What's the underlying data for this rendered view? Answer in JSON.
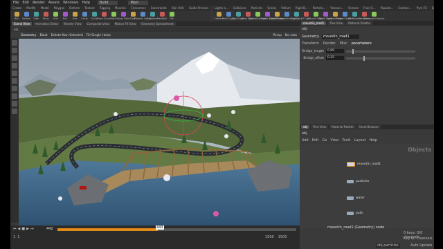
{
  "app": {
    "menu": [
      "File",
      "Edit",
      "Render",
      "Assets",
      "Windows",
      "Help"
    ],
    "build": "Build",
    "desktop": "Main"
  },
  "shelf_left": {
    "tabs": [
      "Create",
      "Modify",
      "Model",
      "Polygon",
      "Deform",
      "Texture",
      "Rigging",
      "Muscles",
      "Characters",
      "Constraints",
      "Hair Utils",
      "Guide Process",
      "Terrain FX",
      "Simple FX",
      "Cloud FX",
      "Volume"
    ],
    "tools": [
      "Box",
      "Sphere",
      "Tube",
      "Torus",
      "Grid",
      "Null",
      "Line",
      "Circle",
      "Curve",
      "Draw Curve",
      "Path",
      "Spray Paint",
      "Font",
      "Platonic Solids",
      "L-System",
      "Metaball",
      "File"
    ]
  },
  "shelf_right": {
    "tabs": [
      "Lights a...",
      "Collisions",
      "Particles",
      "Grains",
      "Vellum",
      "Rigid B...",
      "Particle...",
      "Viscous...",
      "Oceans",
      "Fluid C...",
      "Populat...",
      "Contain...",
      "Pyro FX",
      "Sparse...",
      "FEM",
      "Wires",
      "Crowds",
      "Drive Si..."
    ],
    "tools": [
      "Camera",
      "Point Light",
      "Spot Light",
      "Area Light",
      "Geometry Light",
      "Volume Light",
      "Distant Light",
      "Environment Light",
      "Sky Light",
      "GI Light",
      "Caustic Light",
      "Portal Light",
      "Ambient Light",
      "Stereo Camera",
      "VR Camera",
      "Switcher",
      "Gamepad Camera"
    ]
  },
  "viewport_tabs": [
    "Scene View",
    "Animation Editor",
    "Render View",
    "Composite View",
    "Motion FX View",
    "Geometry Spreadsheet"
  ],
  "viewport": {
    "path": "obj",
    "context": "Geometry",
    "toolbar": [
      "Blast",
      "Delete Non Selected",
      "Fill Single Holes"
    ],
    "view_label": "Persp",
    "cam_label": "No cam"
  },
  "timeline": {
    "frame": "442",
    "marker": "443",
    "start": "1",
    "start2": "1",
    "end": "1500",
    "end2": "1500"
  },
  "param_tabs": [
    "mountin_road1",
    "Tree View",
    "Material Palette"
  ],
  "params": {
    "node_type": "Geometry",
    "node_name": "mountin_road1",
    "path": "obj",
    "tabs": [
      "Transform",
      "Render",
      "Misc",
      "parameters"
    ],
    "active_tab": "parameters",
    "fields": [
      {
        "label": "Bridge_length",
        "value": "0.09",
        "fill": 0.09
      },
      {
        "label": "Bridge_offset",
        "value": "0.25",
        "fill": 0.25
      }
    ]
  },
  "network_tabs": [
    "obj",
    "Tree View",
    "Material Palette",
    "Asset Browser"
  ],
  "network": {
    "path": "obj",
    "menu": [
      "Add",
      "Edit",
      "Go",
      "View",
      "Tools",
      "Layout",
      "Help"
    ],
    "context_label": "Objects",
    "nodes": [
      "mountin_road1",
      "particles",
      "water",
      "path"
    ],
    "footer": "mountin_road1 (Geometry) node"
  },
  "status": {
    "keys": "0 keys, 0/0 channels",
    "key_all": "Key All Channels",
    "app_tab": "obj.particles",
    "auto_update": "Auto Update"
  },
  "colors": {
    "bg": "#3a3a3a",
    "accent": "#e38b1a",
    "sky": "#a9b4c0",
    "water": "#4a6f8f"
  }
}
